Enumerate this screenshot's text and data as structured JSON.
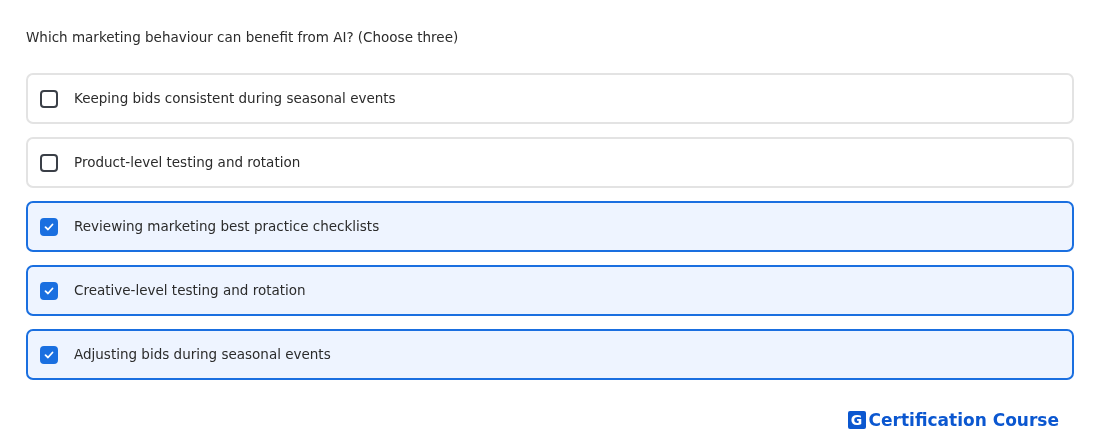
{
  "question": "Which marketing behaviour can benefit from AI? (Choose three)",
  "options": [
    {
      "label": "Keeping bids consistent during seasonal events",
      "checked": false
    },
    {
      "label": "Product-level testing and rotation",
      "checked": false
    },
    {
      "label": "Reviewing marketing best practice checklists",
      "checked": true
    },
    {
      "label": "Creative-level testing and rotation",
      "checked": true
    },
    {
      "label": "Adjusting bids during seasonal events",
      "checked": true
    }
  ],
  "brand": {
    "logo_letter": "G",
    "name": "Certification Course"
  }
}
